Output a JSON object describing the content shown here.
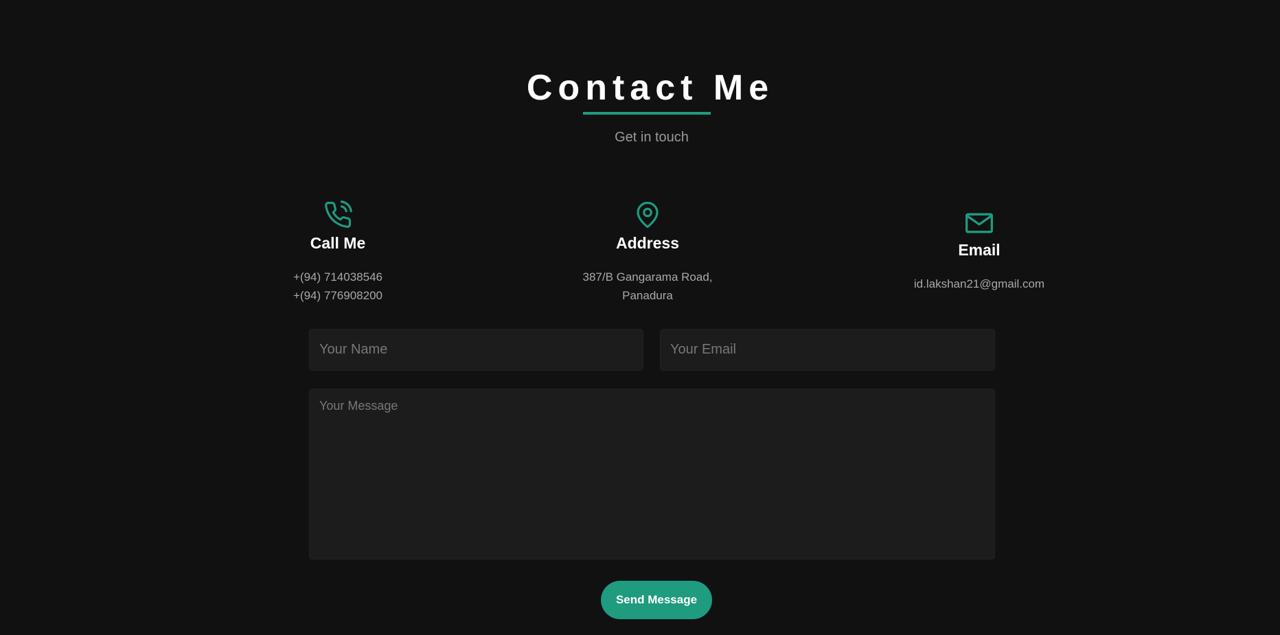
{
  "header": {
    "title": "Contact Me",
    "subtitle": "Get in touch"
  },
  "contact_info": {
    "phone": {
      "icon": "phone-icon",
      "heading": "Call Me",
      "lines": [
        "+(94) 714038546",
        "+(94) 776908200"
      ]
    },
    "address": {
      "icon": "map-pin-icon",
      "heading": "Address",
      "lines": [
        "387/B Gangarama Road,",
        "Panadura"
      ]
    },
    "email": {
      "icon": "mail-icon",
      "heading": "Email",
      "lines": [
        "id.lakshan21@gmail.com"
      ]
    }
  },
  "form": {
    "name_placeholder": "Your Name",
    "name_value": "",
    "email_placeholder": "Your Email",
    "email_value": "",
    "message_placeholder": "Your Message",
    "message_value": "",
    "submit_label": "Send Message"
  },
  "colors": {
    "background": "#111111",
    "accent": "#1f9b7f",
    "input_background": "#1c1c1c",
    "muted_text": "#a9a9a9"
  }
}
